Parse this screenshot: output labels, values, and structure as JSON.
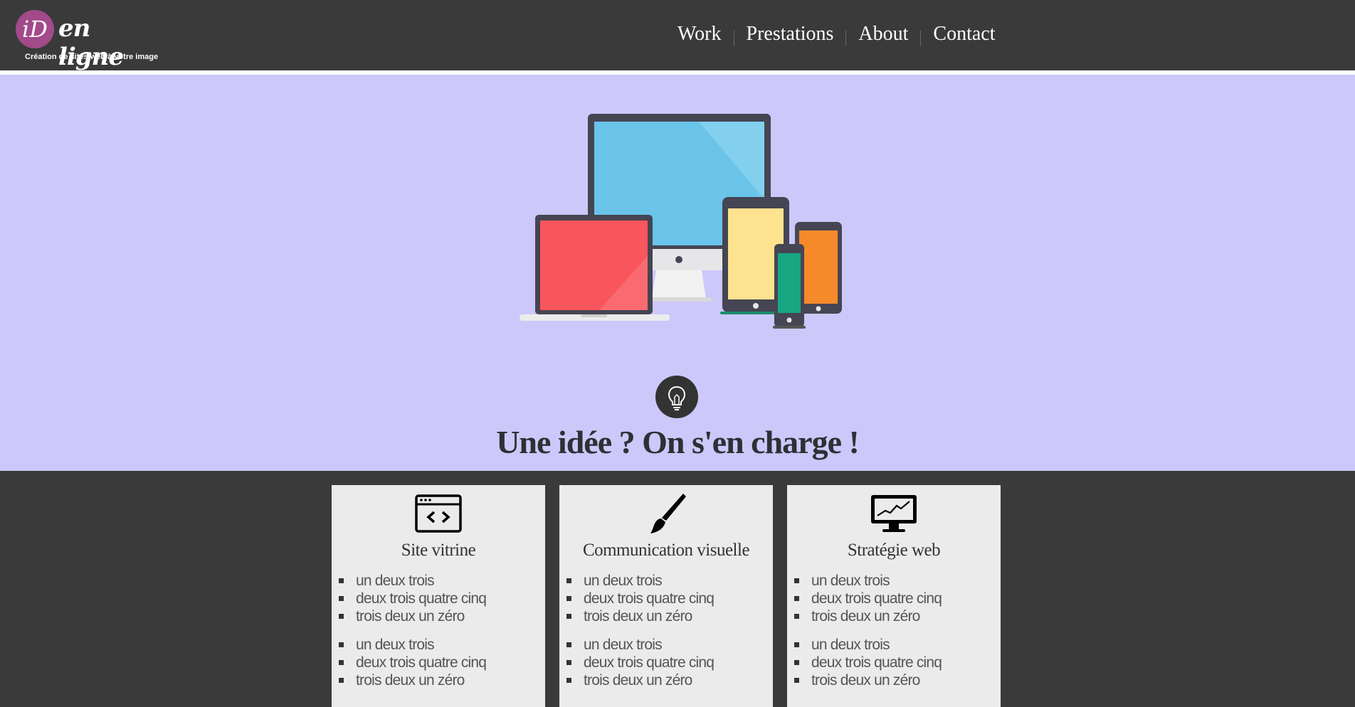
{
  "brand": {
    "logo_letters": "iD",
    "logo_word": "en ligne",
    "tagline": "Création de sites web à votre image"
  },
  "nav": {
    "items": [
      "Work",
      "Prestations",
      "About",
      "Contact"
    ]
  },
  "hero": {
    "title": "Une idée ? On s'en charge !",
    "illustration": "responsive-devices-illustration",
    "icon": "lightbulb-icon"
  },
  "cards": [
    {
      "icon": "code-window-icon",
      "title": "Site vitrine",
      "list_a": [
        "un deux trois",
        "deux trois quatre cinq",
        "trois deux un zéro"
      ],
      "list_b": [
        "un deux trois",
        "deux trois quatre cinq",
        "trois deux un zéro"
      ]
    },
    {
      "icon": "paintbrush-icon",
      "title": "Communication visuelle",
      "list_a": [
        "un deux trois",
        "deux trois quatre cinq",
        "trois deux un zéro"
      ],
      "list_b": [
        "un deux trois",
        "deux trois quatre cinq",
        "trois deux un zéro"
      ]
    },
    {
      "icon": "monitor-chart-icon",
      "title": "Stratégie web",
      "list_a": [
        "un deux trois",
        "deux trois quatre cinq",
        "trois deux un zéro"
      ],
      "list_b": [
        "un deux trois",
        "deux trois quatre cinq",
        "trois deux un zéro"
      ]
    }
  ],
  "colors": {
    "header_bg": "#3a3a3a",
    "hero_bg": "#ccc8fa",
    "card_bg": "#ebebeb",
    "logo_accent": "#a24a8a",
    "screen_blue": "#6ac4ea",
    "laptop_red": "#f9555c",
    "tablet_yellow": "#fde28f",
    "phone_green": "#18a781",
    "phone_orange": "#f68a2b"
  }
}
